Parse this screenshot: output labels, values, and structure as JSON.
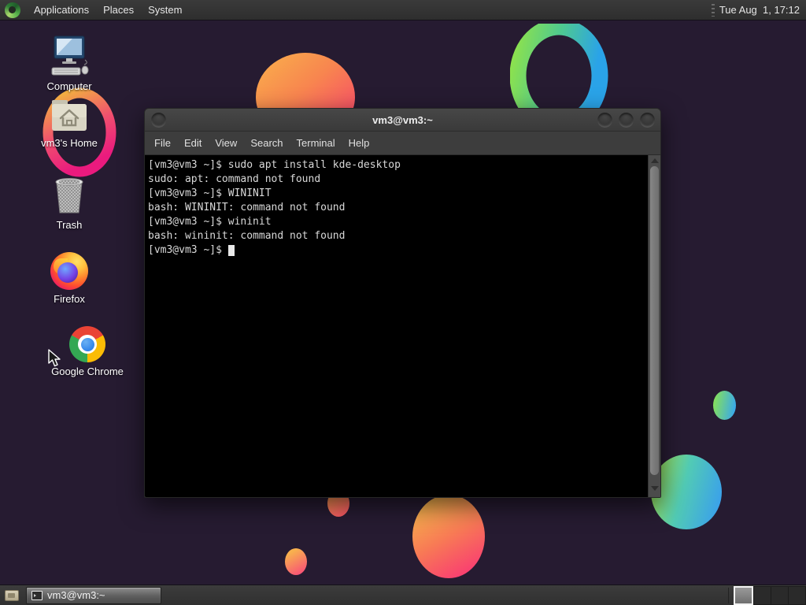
{
  "top_panel": {
    "menus": [
      {
        "label": "Applications"
      },
      {
        "label": "Places"
      },
      {
        "label": "System"
      }
    ],
    "clock": "Tue Aug  1, 17:12"
  },
  "desktop": {
    "icons": [
      {
        "label": "Computer"
      },
      {
        "label": "vm3's Home"
      },
      {
        "label": "Trash"
      },
      {
        "label": "Firefox"
      },
      {
        "label": "Google Chrome"
      }
    ]
  },
  "terminal_window": {
    "title": "vm3@vm3:~",
    "menu": [
      "File",
      "Edit",
      "View",
      "Search",
      "Terminal",
      "Help"
    ],
    "lines": [
      "[vm3@vm3 ~]$ sudo apt install kde-desktop",
      "sudo: apt: command not found",
      "[vm3@vm3 ~]$ WININIT",
      "bash: WININIT: command not found",
      "[vm3@vm3 ~]$ wininit",
      "bash: wininit: command not found",
      "[vm3@vm3 ~]$ "
    ]
  },
  "taskbar": {
    "window_button_label": "vm3@vm3:~",
    "workspace_count": 4
  },
  "colors": {
    "desktop_background": "#261b31",
    "panel_background": "#333333",
    "terminal_background": "#000000",
    "terminal_text": "#d9d9d9",
    "blob_orange": "#f8854f",
    "blob_pink": "#f6476a",
    "blob_green": "#a2e24d",
    "blob_blue": "#3ba2e9"
  }
}
